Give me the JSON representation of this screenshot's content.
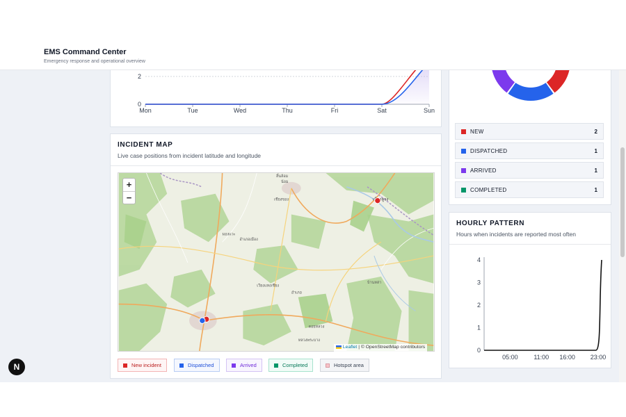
{
  "app": {
    "title": "EMS Command Center",
    "subtitle": "Emergency response and operational overview"
  },
  "weekly_chart": {
    "chart_data": {
      "type": "line",
      "categories": [
        "Mon",
        "Tue",
        "Wed",
        "Thu",
        "Fri",
        "Sat",
        "Sun"
      ],
      "series": [
        {
          "values": [
            0,
            0,
            0,
            0,
            0,
            0,
            3
          ],
          "color": "#dc2626"
        },
        {
          "values": [
            0,
            0,
            0,
            0,
            0,
            0,
            3
          ],
          "color": "#2563eb"
        }
      ],
      "yticks": [
        "0",
        "2"
      ],
      "y_tick_values": [
        0,
        2
      ],
      "ylim": [
        0,
        3
      ]
    }
  },
  "incident_map": {
    "title": "INCIDENT MAP",
    "subtitle": "Live case positions from incident latitude and longitude",
    "zoom_in": "+",
    "zoom_out": "−",
    "attribution_leaflet": "Leaflet",
    "attribution_rest": " | © OpenStreetMap contributors",
    "markers": [
      {
        "status": "new",
        "color": "#dc2626"
      },
      {
        "status": "new",
        "color": "#dc2626"
      },
      {
        "status": "dispatched",
        "color": "#2563eb"
      }
    ],
    "legend": [
      {
        "label": "New incident",
        "color": "#dc2626",
        "text_color": "#b91c1c",
        "border": "#f3b4b4",
        "bg": "#fef5f5"
      },
      {
        "label": "Dispatched",
        "color": "#2563eb",
        "text_color": "#1d4ed8",
        "border": "#b9cdf3",
        "bg": "#f4f7fe"
      },
      {
        "label": "Arrived",
        "color": "#7c3aed",
        "text_color": "#6d28d9",
        "border": "#d4c3f4",
        "bg": "#f8f5fe"
      },
      {
        "label": "Completed",
        "color": "#059669",
        "text_color": "#047857",
        "border": "#a7e3cd",
        "bg": "#f1fbf7"
      },
      {
        "label": "Hotspot area",
        "color": "#f7c3c8",
        "text_color": "#374151",
        "border": "#d1d5db",
        "bg": "#f3f4f6"
      }
    ]
  },
  "status_breakdown": {
    "chart_data": {
      "type": "pie",
      "categories": [
        "NEW",
        "DISPATCHED",
        "ARRIVED",
        "COMPLETED"
      ],
      "values": [
        2,
        1,
        1,
        1
      ],
      "colors": [
        "#dc2626",
        "#2563eb",
        "#7c3aed",
        "#059669"
      ]
    },
    "rows": [
      {
        "label": "NEW",
        "count": "2",
        "color": "#dc2626"
      },
      {
        "label": "DISPATCHED",
        "count": "1",
        "color": "#2563eb"
      },
      {
        "label": "ARRIVED",
        "count": "1",
        "color": "#7c3aed"
      },
      {
        "label": "COMPLETED",
        "count": "1",
        "color": "#059669"
      }
    ]
  },
  "hourly_pattern": {
    "title": "HOURLY PATTERN",
    "subtitle": "Hours when incidents are reported most often",
    "chart_data": {
      "type": "line",
      "x_tick_labels": [
        "05:00",
        "11:00",
        "16:00",
        "23:00"
      ],
      "x_tick_hours": [
        5,
        11,
        16,
        23
      ],
      "yticks": [
        "0",
        "1",
        "2",
        "3",
        "4"
      ],
      "y_tick_values": [
        0,
        1,
        2,
        3,
        4
      ],
      "hours": [
        0,
        22,
        23
      ],
      "values": [
        0,
        0,
        4
      ],
      "ylim": [
        0,
        4
      ],
      "color": "#111111"
    }
  },
  "dev_badge": "N"
}
